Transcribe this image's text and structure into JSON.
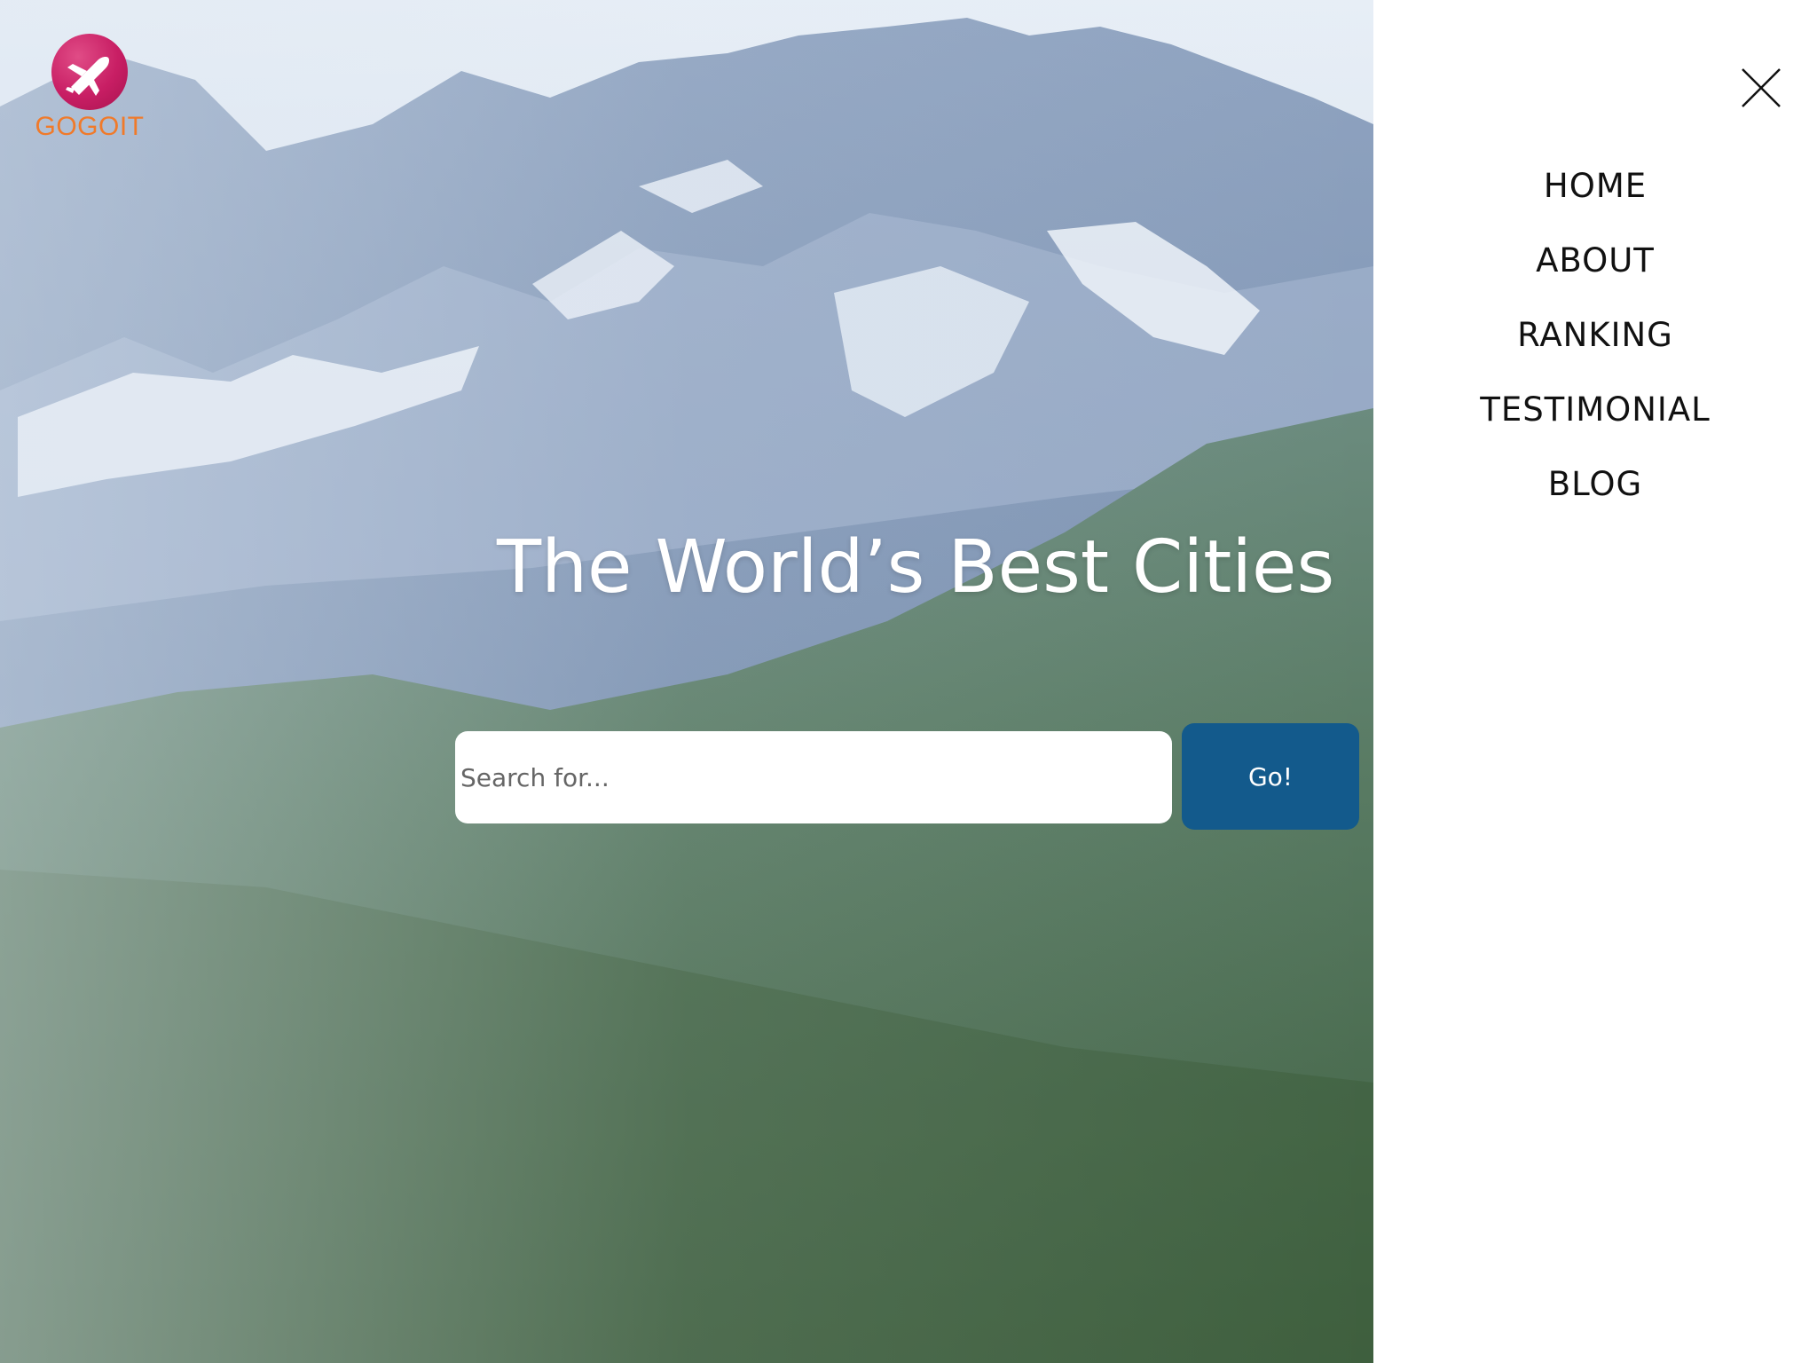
{
  "brand": {
    "name": "GOGOIT",
    "logo_icon": "airplane-icon",
    "logo_color": "#c81e64",
    "text_color": "#f07a2a"
  },
  "hero": {
    "title": "The World’s Best Cities",
    "background": "mountain-landscape-photo"
  },
  "search": {
    "placeholder": "Search for...",
    "value": "",
    "button_label": "Go!",
    "button_color": "#135a8c"
  },
  "menu": {
    "close_icon": "close-icon",
    "items": [
      {
        "label": "HOME"
      },
      {
        "label": "ABOUT"
      },
      {
        "label": "RANKING"
      },
      {
        "label": "TESTIMONIAL"
      },
      {
        "label": "BLOG"
      }
    ]
  }
}
